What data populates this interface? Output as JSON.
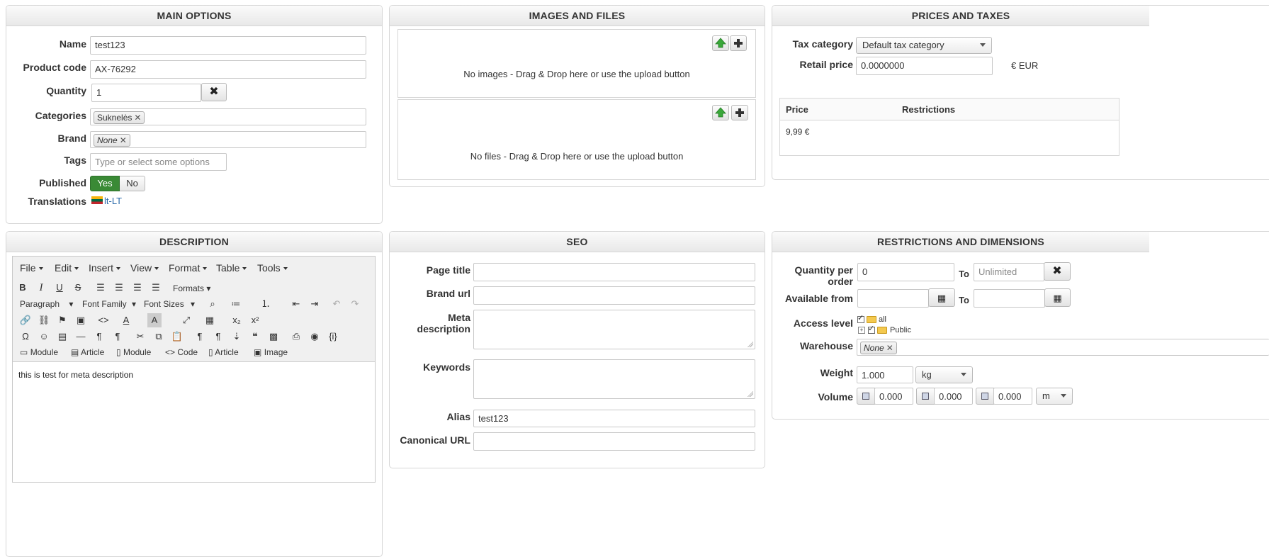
{
  "main_options": {
    "title": "MAIN OPTIONS",
    "name_label": "Name",
    "name_value": "test123",
    "product_code_label": "Product code",
    "product_code_value": "AX-76292",
    "quantity_label": "Quantity",
    "quantity_value": "1",
    "categories_label": "Categories",
    "categories_chip": "Suknelės",
    "brand_label": "Brand",
    "brand_chip": "None",
    "tags_label": "Tags",
    "tags_placeholder": "Type or select some options",
    "published_label": "Published",
    "published_yes": "Yes",
    "published_no": "No",
    "translations_label": "Translations",
    "translation_link": "lt-LT"
  },
  "images_files": {
    "title": "IMAGES AND FILES",
    "images_text": "No images - Drag & Drop here or use the upload button",
    "files_text": "No files - Drag & Drop here or use the upload button"
  },
  "prices": {
    "title": "PRICES AND TAXES",
    "tax_category_label": "Tax category",
    "tax_category_value": "Default tax category",
    "retail_price_label": "Retail price",
    "retail_price_value": "0.0000000",
    "currency": "€ EUR",
    "table_headers": [
      "Price",
      "Restrictions"
    ],
    "rows": [
      {
        "price": "9,99 €"
      }
    ]
  },
  "description": {
    "title": "DESCRIPTION",
    "menus": [
      "File",
      "Edit",
      "Insert",
      "View",
      "Format",
      "Table",
      "Tools"
    ],
    "formats_label": "Formats",
    "paragraph_label": "Paragraph",
    "font_family_label": "Font Family",
    "font_sizes_label": "Font Sizes",
    "plugin_buttons": [
      "Module",
      "Article",
      "Module",
      "Code",
      "Article",
      "Image"
    ],
    "content": "this is test for meta description"
  },
  "seo": {
    "title": "SEO",
    "page_title_label": "Page title",
    "brand_url_label": "Brand url",
    "meta_description_label": "Meta description",
    "keywords_label": "Keywords",
    "alias_label": "Alias",
    "alias_value": "test123",
    "canonical_label": "Canonical URL"
  },
  "restrictions": {
    "title": "RESTRICTIONS AND DIMENSIONS",
    "qty_per_order_label": "Quantity per order",
    "qty_from_value": "0",
    "to_label": "To",
    "qty_to_placeholder": "Unlimited",
    "available_from_label": "Available from",
    "access_level_label": "Access level",
    "access_all": "all",
    "access_public": "Public",
    "warehouse_label": "Warehouse",
    "warehouse_chip": "None",
    "weight_label": "Weight",
    "weight_value": "1.000",
    "weight_unit": "kg",
    "volume_label": "Volume",
    "volume_values": [
      "0.000",
      "0.000",
      "0.000"
    ],
    "volume_unit": "m"
  },
  "colors": {
    "published_green": "#3a8a35",
    "link_blue": "#2a6aaa",
    "upload_green": "#3aa83a"
  }
}
